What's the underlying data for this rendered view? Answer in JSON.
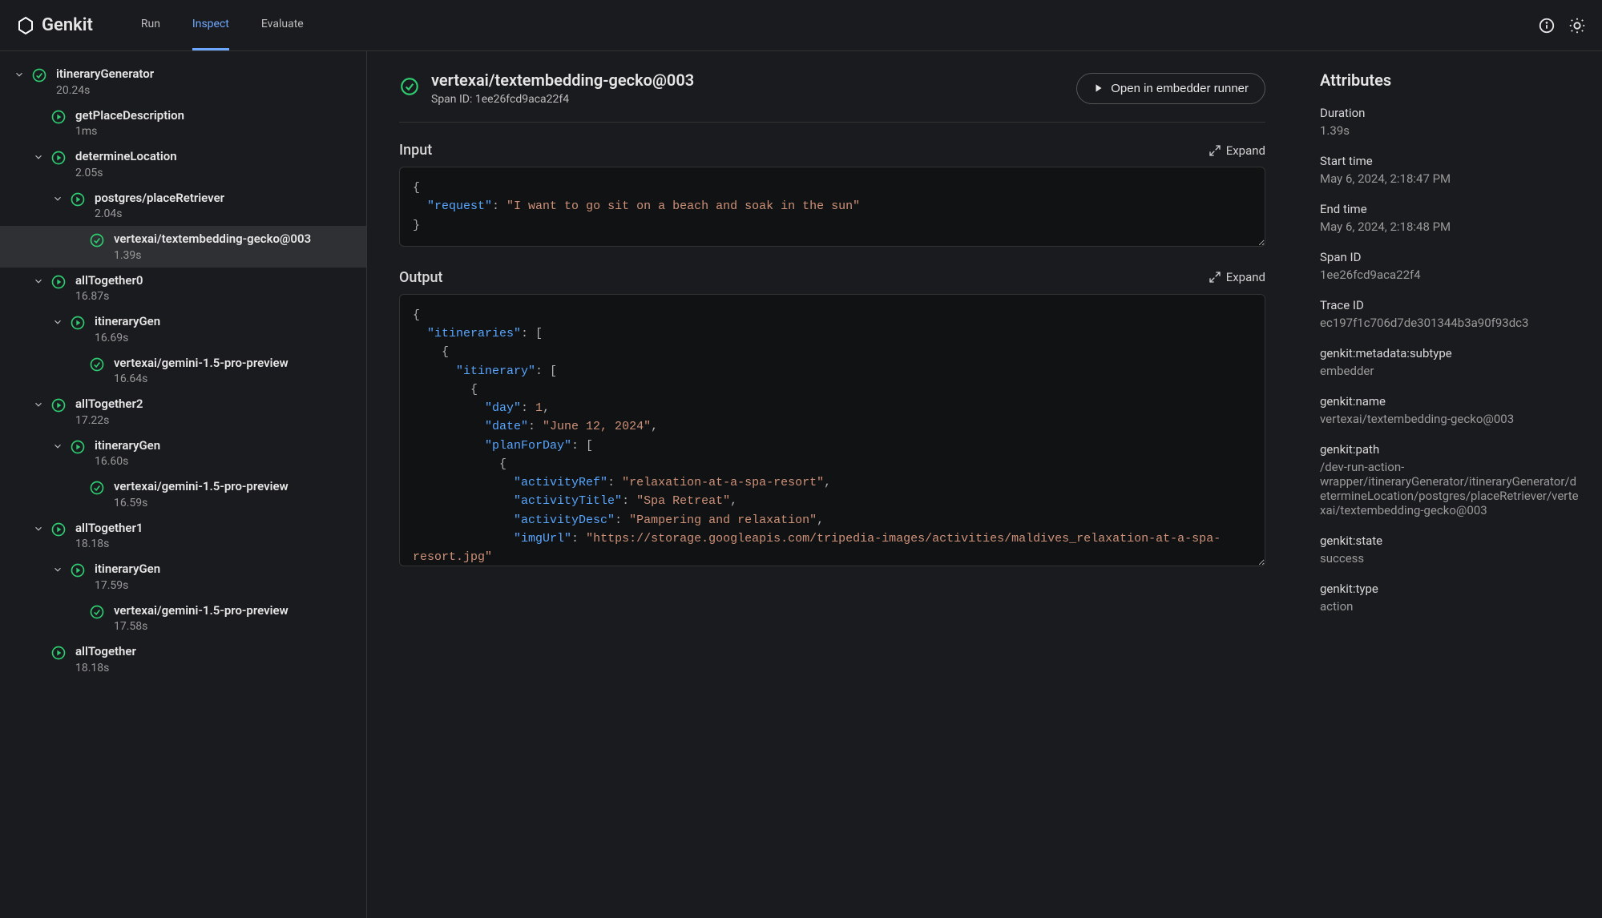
{
  "app": {
    "name": "Genkit"
  },
  "nav": {
    "run": "Run",
    "inspect": "Inspect",
    "evaluate": "Evaluate"
  },
  "tree": [
    {
      "id": "itineraryGenerator",
      "label": "itineraryGenerator",
      "sub": "20.24s",
      "depth": 0,
      "chev": true,
      "icon": "check"
    },
    {
      "id": "getPlaceDescription",
      "label": "getPlaceDescription",
      "sub": "1ms",
      "depth": 1,
      "chev": false,
      "icon": "play"
    },
    {
      "id": "determineLocation",
      "label": "determineLocation",
      "sub": "2.05s",
      "depth": 1,
      "chev": true,
      "icon": "play"
    },
    {
      "id": "placeRetriever",
      "label": "postgres/placeRetriever",
      "sub": "2.04s",
      "depth": 2,
      "chev": true,
      "icon": "play"
    },
    {
      "id": "textembedding",
      "label": "vertexai/textembedding-gecko@003",
      "sub": "1.39s",
      "depth": 3,
      "chev": false,
      "icon": "check",
      "selected": true
    },
    {
      "id": "allTogether0",
      "label": "allTogether0",
      "sub": "16.87s",
      "depth": 1,
      "chev": true,
      "icon": "play"
    },
    {
      "id": "itineraryGen0",
      "label": "itineraryGen",
      "sub": "16.69s",
      "depth": 2,
      "chev": true,
      "icon": "play"
    },
    {
      "id": "gemini0",
      "label": "vertexai/gemini-1.5-pro-preview",
      "sub": "16.64s",
      "depth": 3,
      "chev": false,
      "icon": "check"
    },
    {
      "id": "allTogether2",
      "label": "allTogether2",
      "sub": "17.22s",
      "depth": 1,
      "chev": true,
      "icon": "play"
    },
    {
      "id": "itineraryGen2",
      "label": "itineraryGen",
      "sub": "16.60s",
      "depth": 2,
      "chev": true,
      "icon": "play"
    },
    {
      "id": "gemini2",
      "label": "vertexai/gemini-1.5-pro-preview",
      "sub": "16.59s",
      "depth": 3,
      "chev": false,
      "icon": "check"
    },
    {
      "id": "allTogether1",
      "label": "allTogether1",
      "sub": "18.18s",
      "depth": 1,
      "chev": true,
      "icon": "play"
    },
    {
      "id": "itineraryGen1",
      "label": "itineraryGen",
      "sub": "17.59s",
      "depth": 2,
      "chev": true,
      "icon": "play"
    },
    {
      "id": "gemini1",
      "label": "vertexai/gemini-1.5-pro-preview",
      "sub": "17.58s",
      "depth": 3,
      "chev": false,
      "icon": "check"
    },
    {
      "id": "allTogether",
      "label": "allTogether",
      "sub": "18.18s",
      "depth": 1,
      "chev": false,
      "icon": "play"
    }
  ],
  "detail": {
    "title": "vertexai/textembedding-gecko@003",
    "span_line_prefix": "Span ID: ",
    "span_id": "1ee26fcd9aca22f4",
    "open_button": "Open in embedder runner",
    "input_label": "Input",
    "output_label": "Output",
    "expand_label": "Expand",
    "input_json": {
      "request": "I want to go sit on a beach and soak in the sun"
    },
    "output_json_tokens": [
      {
        "t": "p",
        "v": "{"
      },
      {
        "t": "br"
      },
      {
        "t": "sp",
        "v": 2
      },
      {
        "t": "k",
        "v": "\"itineraries\""
      },
      {
        "t": "p",
        "v": ": ["
      },
      {
        "t": "br"
      },
      {
        "t": "sp",
        "v": 4
      },
      {
        "t": "p",
        "v": "{"
      },
      {
        "t": "br"
      },
      {
        "t": "sp",
        "v": 6
      },
      {
        "t": "k",
        "v": "\"itinerary\""
      },
      {
        "t": "p",
        "v": ": ["
      },
      {
        "t": "br"
      },
      {
        "t": "sp",
        "v": 8
      },
      {
        "t": "p",
        "v": "{"
      },
      {
        "t": "br"
      },
      {
        "t": "sp",
        "v": 10
      },
      {
        "t": "k",
        "v": "\"day\""
      },
      {
        "t": "p",
        "v": ": "
      },
      {
        "t": "n",
        "v": "1"
      },
      {
        "t": "p",
        "v": ","
      },
      {
        "t": "br"
      },
      {
        "t": "sp",
        "v": 10
      },
      {
        "t": "k",
        "v": "\"date\""
      },
      {
        "t": "p",
        "v": ": "
      },
      {
        "t": "s",
        "v": "\"June 12, 2024\""
      },
      {
        "t": "p",
        "v": ","
      },
      {
        "t": "br"
      },
      {
        "t": "sp",
        "v": 10
      },
      {
        "t": "k",
        "v": "\"planForDay\""
      },
      {
        "t": "p",
        "v": ": ["
      },
      {
        "t": "br"
      },
      {
        "t": "sp",
        "v": 12
      },
      {
        "t": "p",
        "v": "{"
      },
      {
        "t": "br"
      },
      {
        "t": "sp",
        "v": 14
      },
      {
        "t": "k",
        "v": "\"activityRef\""
      },
      {
        "t": "p",
        "v": ": "
      },
      {
        "t": "s",
        "v": "\"relaxation-at-a-spa-resort\""
      },
      {
        "t": "p",
        "v": ","
      },
      {
        "t": "br"
      },
      {
        "t": "sp",
        "v": 14
      },
      {
        "t": "k",
        "v": "\"activityTitle\""
      },
      {
        "t": "p",
        "v": ": "
      },
      {
        "t": "s",
        "v": "\"Spa Retreat\""
      },
      {
        "t": "p",
        "v": ","
      },
      {
        "t": "br"
      },
      {
        "t": "sp",
        "v": 14
      },
      {
        "t": "k",
        "v": "\"activityDesc\""
      },
      {
        "t": "p",
        "v": ": "
      },
      {
        "t": "s",
        "v": "\"Pampering and relaxation\""
      },
      {
        "t": "p",
        "v": ","
      },
      {
        "t": "br"
      },
      {
        "t": "sp",
        "v": 14
      },
      {
        "t": "k",
        "v": "\"imgUrl\""
      },
      {
        "t": "p",
        "v": ": "
      },
      {
        "t": "s",
        "v": "\"https://storage.googleapis.com/tripedia-images/activities/maldives_relaxation-at-a-spa-resort.jpg\""
      },
      {
        "t": "br"
      },
      {
        "t": "sp",
        "v": 12
      },
      {
        "t": "p",
        "v": "},"
      },
      {
        "t": "br"
      },
      {
        "t": "sp",
        "v": 12
      },
      {
        "t": "p",
        "v": "{"
      }
    ]
  },
  "attributes": {
    "heading": "Attributes",
    "items": [
      {
        "label": "Duration",
        "value": "1.39s"
      },
      {
        "label": "Start time",
        "value": "May 6, 2024, 2:18:47 PM"
      },
      {
        "label": "End time",
        "value": "May 6, 2024, 2:18:48 PM"
      },
      {
        "label": "Span ID",
        "value": "1ee26fcd9aca22f4"
      },
      {
        "label": "Trace ID",
        "value": "ec197f1c706d7de301344b3a90f93dc3"
      },
      {
        "label": "genkit:metadata:subtype",
        "value": "embedder"
      },
      {
        "label": "genkit:name",
        "value": "vertexai/textembedding-gecko@003"
      },
      {
        "label": "genkit:path",
        "value": "/dev-run-action-wrapper/itineraryGenerator/itineraryGenerator/determineLocation/postgres/placeRetriever/vertexai/textembedding-gecko@003"
      },
      {
        "label": "genkit:state",
        "value": "success"
      },
      {
        "label": "genkit:type",
        "value": "action"
      }
    ]
  }
}
